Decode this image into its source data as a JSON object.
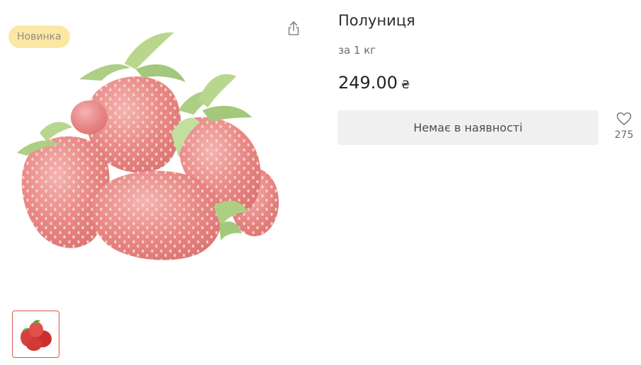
{
  "badge": {
    "label": "Новинка"
  },
  "icons": {
    "share": "share-icon",
    "heart": "heart-icon"
  },
  "product": {
    "title": "Полуниця",
    "unit": "за 1 кг",
    "price": "249.00",
    "currency": "₴",
    "availability_label": "Немає в наявності",
    "favorites_count": "275"
  },
  "colors": {
    "badge_bg": "#fbe7a1",
    "thumb_border": "#d9534f",
    "button_bg": "#f0f0f0"
  }
}
